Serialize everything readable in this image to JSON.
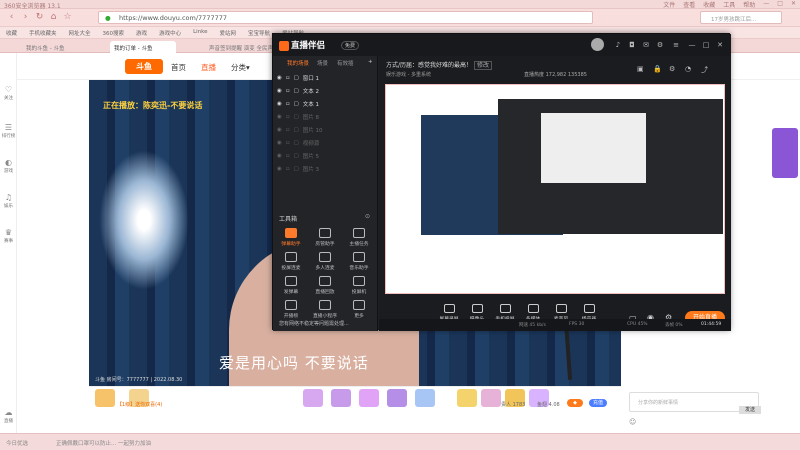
{
  "browser": {
    "title": "360安全浏览器 13.1",
    "menu": [
      "文件",
      "查看",
      "收藏",
      "工具",
      "帮助"
    ],
    "url": "https://www.douyu.com/7777777",
    "search_placeholder": "17岁男孩跳江后...",
    "bookmarks": [
      "收藏",
      "手机收藏夹",
      "网址大全",
      "360搜索",
      "游戏",
      "游戏中心",
      "Linke",
      "爱站网",
      "宝宝导航",
      "爱站导航"
    ],
    "tabs": [
      "我的斗鱼 - 斗鱼",
      "我的订单 - 斗鱼",
      "声音签到提醒 演变 全民声音全看...",
      "—",
      "—"
    ]
  },
  "sidenav": [
    {
      "icon": "heart-icon",
      "label": "关注"
    },
    {
      "icon": "list-icon",
      "label": "排行榜"
    },
    {
      "icon": "gamepad-icon",
      "label": "游戏"
    },
    {
      "icon": "entertainment-icon",
      "label": "娱乐"
    },
    {
      "icon": "trophy-icon",
      "label": "赛事"
    },
    {
      "icon": "cloud-icon",
      "label": "直播"
    }
  ],
  "site": {
    "logo": "斗鱼",
    "nav": [
      "首页",
      "直播",
      "分类▾"
    ]
  },
  "video": {
    "now_playing": "正在播放：陈奕迅-不要说话",
    "subtitle": "爱是用心吗 不要说话",
    "stamp": "斗鱼 房间号：7777777 | 2022.08.30"
  },
  "giftbar": {
    "promo": "【1级】送你双喜(4)",
    "fans_count": "贵人 1783",
    "gold": "鱼翅 4.08",
    "recharge": "充值"
  },
  "chat": {
    "input_placeholder": "分享你的新鲜事情",
    "send": "发送"
  },
  "status": {
    "left": "今日优选",
    "mid": "正确佩戴口罩可以防止... 一起努力加油"
  },
  "app": {
    "name": "直播伴侣",
    "badge": "免费",
    "left_tabs": [
      "我的场景",
      "场景",
      "有效插"
    ],
    "sources": [
      {
        "name": "窗口 1",
        "dim": false
      },
      {
        "name": "文本 2",
        "dim": false
      },
      {
        "name": "文本 1",
        "dim": false
      },
      {
        "name": "图片 8",
        "dim": true
      },
      {
        "name": "图片 10",
        "dim": true
      },
      {
        "name": "视频源",
        "dim": true
      },
      {
        "name": "图片 5",
        "dim": true
      },
      {
        "name": "图片 3",
        "dim": true
      }
    ],
    "toolbox_title": "工具箱",
    "tools": [
      {
        "label": "弹幕助手",
        "hot": true
      },
      {
        "label": "房管助手",
        "hot": false
      },
      {
        "label": "主播任务",
        "hot": false
      },
      {
        "label": "投屏连麦",
        "hot": false
      },
      {
        "label": "多人连麦",
        "hot": false
      },
      {
        "label": "音乐助手",
        "hot": false
      },
      {
        "label": "发弹幕",
        "hot": false
      },
      {
        "label": "直播回放",
        "hot": false
      },
      {
        "label": "投屏机",
        "hot": false
      },
      {
        "label": "开播榜",
        "hot": false
      },
      {
        "label": "直播小程序",
        "hot": false
      },
      {
        "label": "更多",
        "hot": false
      }
    ],
    "warning": "您有网络不稳定等问题需处理...",
    "main_title": "方式/历届：感觉我好难的最高！",
    "main_edit": "修改",
    "main_tag": "娱乐游戏 - 多重系统",
    "stats": [
      "直播热度  172,982",
      "  135385"
    ],
    "controls": [
      "屏幕录屏",
      "摄像头",
      "手机投屏",
      "多媒体",
      "麦克风",
      "扬声器"
    ],
    "go_live": "开始直播",
    "footer": [
      "网速  45 kb/s",
      "FPS 30",
      "CPU 45%",
      "丢帧 0%",
      "01:44:59"
    ]
  }
}
